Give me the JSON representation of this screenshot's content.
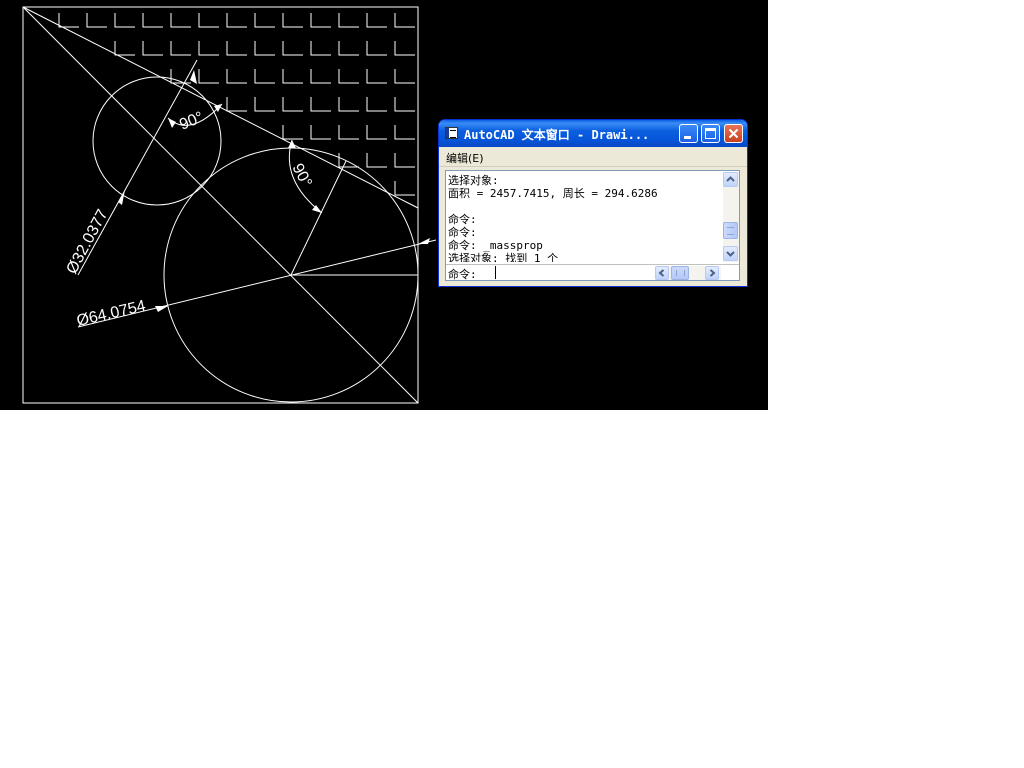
{
  "window": {
    "title": "AutoCAD 文本窗口 - Drawi...",
    "menu_edit": "编辑(E)"
  },
  "history": [
    "选择对象:",
    "面积 = 2457.7415, 周长 = 294.6286",
    "",
    "命令:",
    "命令:",
    "命令: _massprop",
    "选择对象: 找到 1 个"
  ],
  "command": {
    "prompt": "命令:",
    "value": ""
  },
  "drawing": {
    "dim_small_diameter": "Ø32.0377",
    "dim_large_diameter": "Ø64.0754",
    "angle_small": "90°",
    "angle_large": "90°",
    "line_color": "#ffffff",
    "background_color": "#000000"
  },
  "icons": {
    "app": "autocad-text-window-icon",
    "minimize": "minimize-icon",
    "maximize": "maximize-icon",
    "close": "close-icon"
  }
}
